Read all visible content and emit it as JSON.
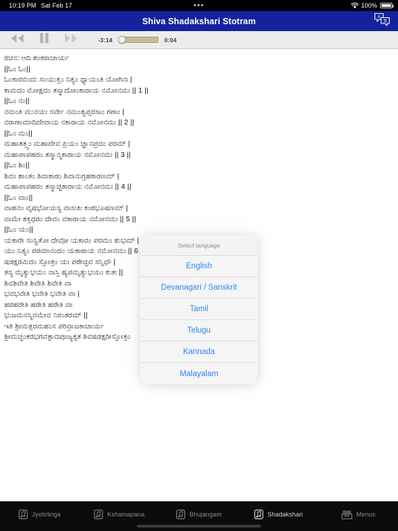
{
  "status_bar": {
    "time": "10:19 PM",
    "date": "Sat Feb 17",
    "center_dots": "•••",
    "wifi_icon": "wifi-icon",
    "battery_percent": "100%",
    "battery_icon": "battery-icon"
  },
  "nav_bar": {
    "title": "Shiva Shadakshari Stotram",
    "translate_icon": "translate-icon",
    "background_color": "#15229e",
    "title_color": "#ffffff"
  },
  "player": {
    "rewind_icon": "rewind-icon",
    "pause_icon": "pause-icon",
    "forward_icon": "fast-forward-icon",
    "time_remaining": "-3:14",
    "time_elapsed": "0:04",
    "progress_percent": 2,
    "track_color": "#c9bb93"
  },
  "lyrics": {
    "lines": [
      "ರಚನ: ಆದಿ ಶಂಕರಾಚಾರ್ಯ",
      "||ಓಂ ಓಂ||",
      "ಓಂಕಾರಬಿಂದು ಸಂಯುಕ್ತಂ ನಿತ್ಯಂ ಧ್ಯಾಯಂತಿ ಯೋಗಿನಃ |",
      "ಕಾಮದಂ ಮೋಕ್ಷದಂ ತಸ್ಮಾದೋಂಕಾರಾಯ ನಮೋನಮಃ || 1 ||",
      "||ಓಂ ನಂ||",
      "ನಮಂತಿ ಮುನಯಃ ಸರ್ವೇ ನಮಂತ್ಯಪ್ಸರಸಾಂ ಗಣಾಃ |",
      "ನರಾಣಾಮಾದಿದೇವಾಯ ನಕಾರಾಯ ನಮೋನಮಃ || 2 ||",
      "||ಓಂ ಮಂ||",
      "ಮಹಾತತ್ತ್ವಂ ಮಹಾದೇವ ಪ್ರಿಯಂ ಜ್ಞಾನಪ್ರದಂ ಪರಮ್ |",
      "ಮಹಾಪಾಪಹರಂ ತಸ್ಮಾನ್ಮಕಾರಾಯ ನಮೋನಮಃ || 3 ||",
      "||ಓಂ ಶಿಂ||",
      "ಶಿವಂ ಶಾಂತಂ ಶಿವಾಕಾರಂ ಶಿವಾನುಗ್ರಹಕಾರಣಮ್ |",
      "ಮಹಾಪಾಪಹರಂ ತಸ್ಮಾಚ್ಛಿಕಾರಾಯ ನಮೋನಮಃ || 4 ||",
      "||ಓಂ ವಾಂ||",
      "ವಾಹನಂ ವೃಷಭೋಯಸ್ಯ ವಾಸುಕಿಃ ಕಂಠಭೂಷಣಮ್ |",
      "ವಾಮೇ ಶಕ್ತಿಧರಂ ದೇವಂ ವಕಾರಾಯ ನಮೋನಮಃ || 5 ||",
      "||ಓಂ ಯಂ||",
      "ಯಕಾರೇ ಸಂಸ್ಥಿತೋ ದೇವೋ ಯಕಾರಂ ಪರಮಂ ಶುಭಮ್ |",
      "ಯಂ ನಿತ್ಯಂ ಪರಮಾನಂದಂ ಯಕಾರಾಯ ನಮೋನಮಃ || 6 ||",
      "ಷಡಕ್ಷರಮಿದಂ ಸ್ತೋತ್ರಂ ಯಃ ಪಠೇಚ್ಛಿವ ಸನ್ನಿಧೌ |",
      "ತಸ್ಯ ಮೃತ್ಯುಭಯಂ ನಾಸ್ತಿ ಹ್ಯಪಮೃತ್ಯುಭಯಂ ಕುತಃ ||",
      "ಶಿವಶಿವೇತಿ ಶಿವೇತಿ ಶಿವೇತಿ ವಾ",
      "ಭವಭವೇತಿ ಭವೇತಿ ಭವೇತಿ ವಾ |",
      "ಹರಹರೇತಿ ಹರೇತಿ ಹರೇತಿ ವಾ",
      "ಭುಜಮನಸ್ಮಿವಮೇವ ನಿರಂತರಮ್ ||",
      "ಇತಿ ಶ್ರೀಮತ್ಪರಮಹಂಸ ಪರಿವ್ರಾಜಕಾಚಾರ್ಯ",
      "ಶ್ರೀಮಚ್ಛಂಕರಭಗವತ್ಪಾದಪೂಜ್ಯಕೃತ ಶಿವಷಡಕ್ಷರೀಸ್ತೋತ್ರಂ"
    ]
  },
  "dialog": {
    "title": "Select language",
    "options": [
      {
        "label": "English"
      },
      {
        "label": "Devanagari / Sanskrit"
      },
      {
        "label": "Tamil"
      },
      {
        "label": "Telugu"
      },
      {
        "label": "Kannada"
      },
      {
        "label": "Malayalam"
      }
    ],
    "accent_color": "#2f86f0"
  },
  "tab_bar": {
    "tabs": [
      {
        "label": "Jyotirlinga",
        "icon": "music-note-icon",
        "active": false
      },
      {
        "label": "Kshamapana",
        "icon": "music-note-icon",
        "active": false
      },
      {
        "label": "Bhujangam",
        "icon": "music-note-icon",
        "active": false
      },
      {
        "label": "Shadakshari",
        "icon": "music-note-icon",
        "active": true
      },
      {
        "label": "Menus",
        "icon": "tray-icon",
        "active": false
      }
    ]
  }
}
